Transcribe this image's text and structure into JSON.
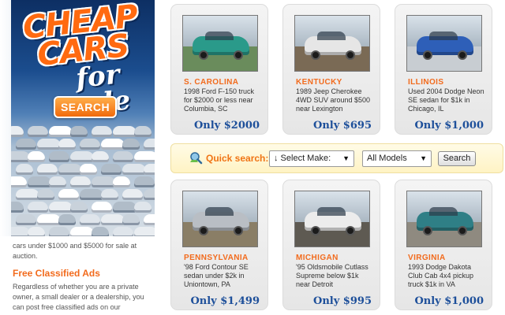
{
  "sidebar": {
    "logo": {
      "line1": "CHEAP",
      "line2": "CARS",
      "line3": "for sale"
    },
    "search_button": "SEARCH",
    "intro_text": "cars under $1000 and $5000 for sale at auction.",
    "classifieds_heading": "Free Classified Ads",
    "classifieds_text": "Regardless of whether you are a private owner, a small dealer or a dealership, you can post free classified ads on our"
  },
  "quick_search": {
    "label": "Quick search:",
    "make_selected": "↓ Select Make:",
    "model_selected": "All Models",
    "button": "Search"
  },
  "listings": [
    {
      "state": "S. CAROLINA",
      "desc": "1998 Ford F-150 truck for $2000 or less near Columbia, SC",
      "price": "Only $2000",
      "car_color": "#2a9a8a",
      "bg": "#6a8c5c"
    },
    {
      "state": "KENTUCKY",
      "desc": "1989 Jeep Cherokee 4WD SUV around $500 near Lexington",
      "price": "Only $695",
      "car_color": "#e6e6e6",
      "bg": "#7a6a55"
    },
    {
      "state": "ILLINOIS",
      "desc": "Used 2004 Dodge Neon SE sedan for $1k in Chicago, IL",
      "price": "Only $1,000",
      "car_color": "#2e5fb8",
      "bg": "#c8cdd2"
    },
    {
      "state": "PENNSYLVANIA",
      "desc": "'98 Ford Contour SE sedan under $2k in Uniontown, PA",
      "price": "Only $1,499",
      "car_color": "#b9bec4",
      "bg": "#8a7e66"
    },
    {
      "state": "MICHIGAN",
      "desc": "'95 Oldsmobile Cutlass Supreme below $1k near Detroit",
      "price": "Only $995",
      "car_color": "#ececec",
      "bg": "#5e5a52"
    },
    {
      "state": "VIRGINIA",
      "desc": "1993 Dodge Dakota Club Cab 4x4 pickup truck $1k in VA",
      "price": "Only $1,000",
      "car_color": "#2f7f86",
      "bg": "#8f8a80"
    }
  ],
  "colors": {
    "accent_orange": "#f26b1d",
    "price_blue": "#1d4f9a",
    "quick_bg": "#fff3c4"
  }
}
